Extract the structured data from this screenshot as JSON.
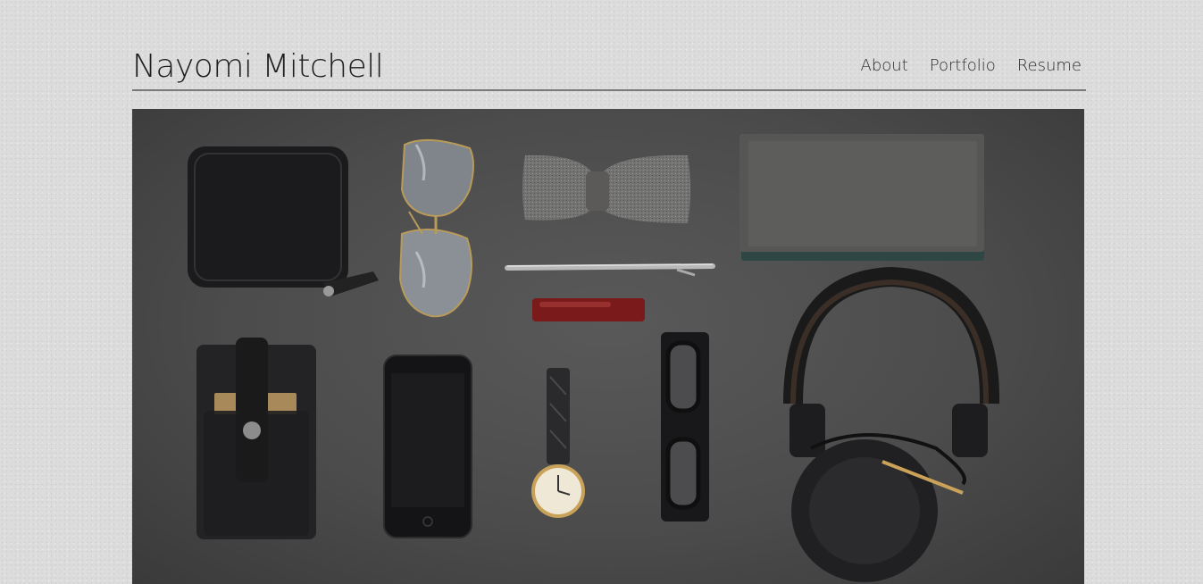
{
  "site": {
    "title": "Nayomi Mitchell"
  },
  "nav": {
    "items": [
      {
        "label": "About"
      },
      {
        "label": "Portfolio"
      },
      {
        "label": "Resume"
      }
    ]
  },
  "hero": {
    "items": [
      "wallet",
      "aviator-sunglasses",
      "bow-tie",
      "notebook",
      "pen",
      "red-lighter",
      "phone-case",
      "smartphone",
      "wristwatch",
      "eyeglasses",
      "headphones"
    ]
  }
}
